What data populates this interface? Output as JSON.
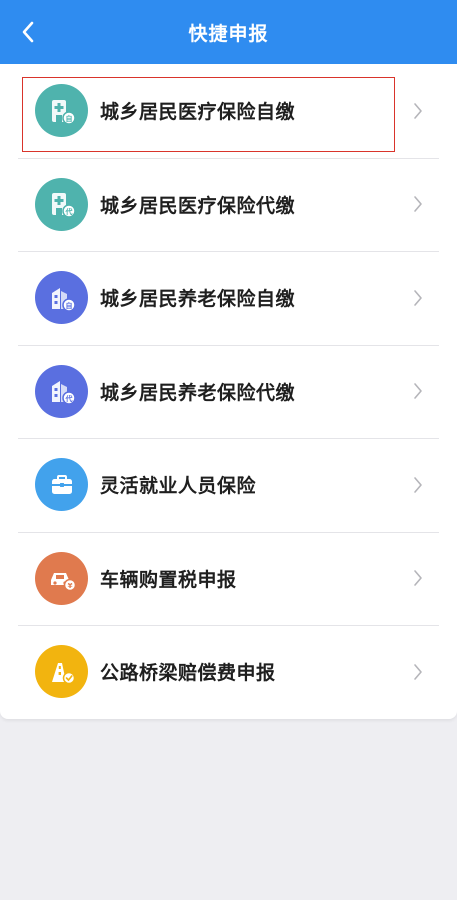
{
  "header": {
    "title": "快捷申报",
    "background": "#2f8cf0"
  },
  "items": [
    {
      "label": "城乡居民医疗保险自缴",
      "icon": "medical-insurance-self-pay-icon",
      "color": "#4fb3ad"
    },
    {
      "label": "城乡居民医疗保险代缴",
      "icon": "medical-insurance-proxy-pay-icon",
      "color": "#4fb3ad"
    },
    {
      "label": "城乡居民养老保险自缴",
      "icon": "pension-insurance-self-pay-icon",
      "color": "#5a6fe0"
    },
    {
      "label": "城乡居民养老保险代缴",
      "icon": "pension-insurance-proxy-pay-icon",
      "color": "#5a6fe0"
    },
    {
      "label": "灵活就业人员保险",
      "icon": "briefcase-icon",
      "color": "#42a2ec"
    },
    {
      "label": "车辆购置税申报",
      "icon": "car-icon",
      "color": "#e07a4e"
    },
    {
      "label": "公路桥梁赔偿费申报",
      "icon": "road-bridge-icon",
      "color": "#f2b40f"
    }
  ],
  "highlight_color": "#d9342b"
}
